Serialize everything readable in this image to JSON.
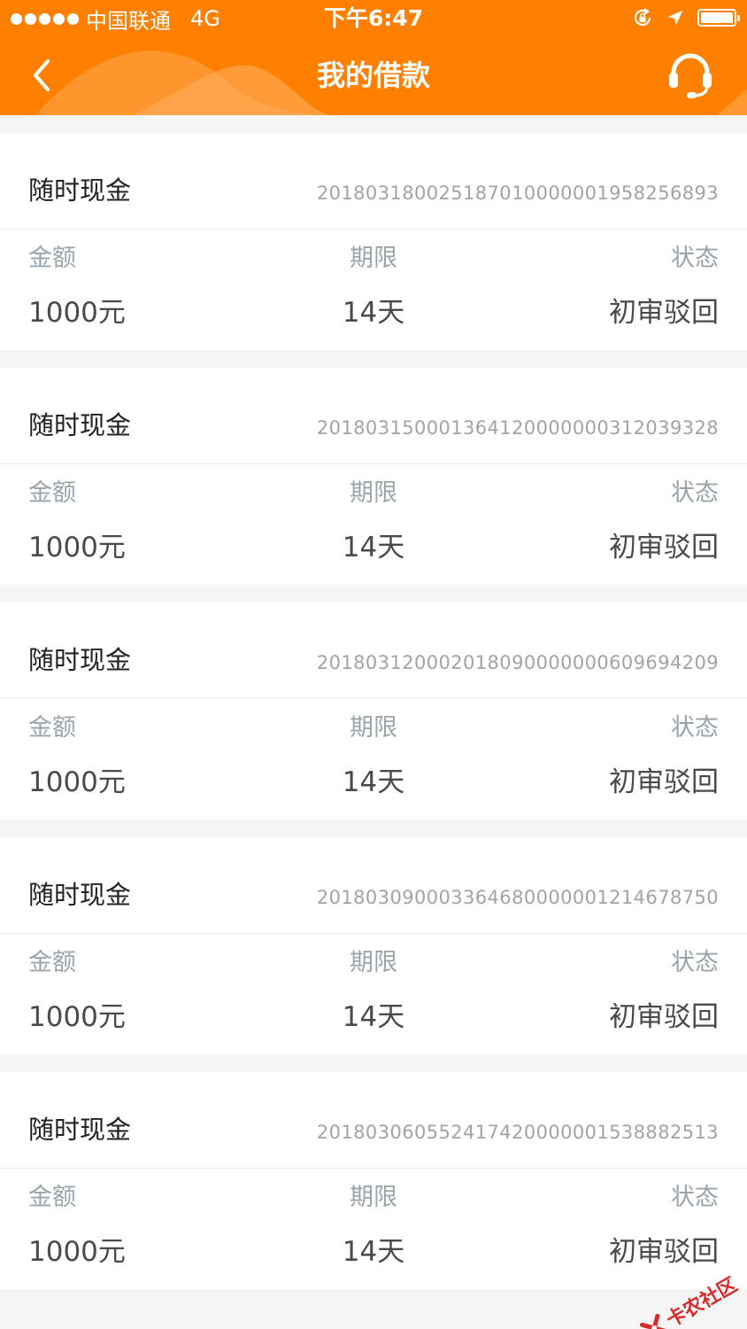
{
  "status_bar": {
    "carrier": "中国联通",
    "network": "4G",
    "time": "下午6:47"
  },
  "nav": {
    "title": "我的借款",
    "back_icon": "chevron-left-icon",
    "service_icon": "headset-icon"
  },
  "colors": {
    "header": "#ff8000",
    "background": "#f5f5f5",
    "card": "#ffffff"
  },
  "labels": {
    "amount": "金额",
    "term": "期限",
    "status": "状态"
  },
  "loans": [
    {
      "product": "随时现金",
      "order_no": "201803180025187010000001958256893",
      "amount": "1000元",
      "term": "14天",
      "status": "初审驳回"
    },
    {
      "product": "随时现金",
      "order_no": "201803150001364120000000312039328",
      "amount": "1000元",
      "term": "14天",
      "status": "初审驳回"
    },
    {
      "product": "随时现金",
      "order_no": "201803120002018090000000609694209",
      "amount": "1000元",
      "term": "14天",
      "status": "初审驳回"
    },
    {
      "product": "随时现金",
      "order_no": "201803090003364680000001214678750",
      "amount": "1000元",
      "term": "14天",
      "status": "初审驳回"
    },
    {
      "product": "随时现金",
      "order_no": "201803060552417420000001538882513",
      "amount": "1000元",
      "term": "14天",
      "status": "初审驳回"
    }
  ],
  "watermark": {
    "text": "卡农社区"
  }
}
